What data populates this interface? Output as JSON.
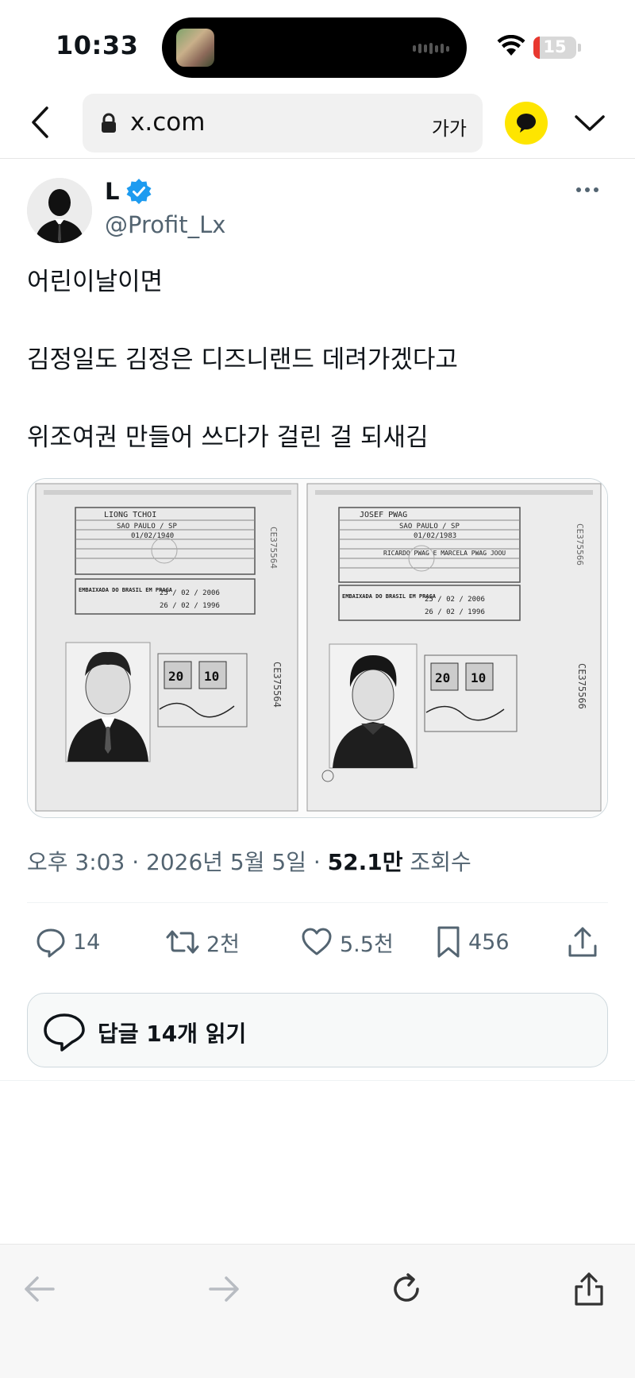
{
  "status_bar": {
    "time": "10:33",
    "battery_level": "15"
  },
  "browser": {
    "url": "x.com",
    "text_size_label": "가가",
    "icons": {
      "back": "chevron-left-icon",
      "lock": "lock-icon",
      "kakao": "speech-bubble-icon",
      "menu": "chevron-down-icon"
    }
  },
  "tweet": {
    "display_name": "L",
    "username": "@Profit_Lx",
    "verified": true,
    "text_lines": [
      "어린이날이면",
      "김정일도 김정은 디즈니랜드 데려가겠다고",
      "위조여권 만들어 쓰다가 걸린 걸 되새김"
    ],
    "timestamp": "오후 3:03 · 2026년 5월 5일 · ",
    "views_count": "52.1만",
    "views_label": " 조회수",
    "actions": {
      "replies": "14",
      "reposts": "2천",
      "likes": "5.5천",
      "bookmarks": "456"
    },
    "read_replies_label": "답글 14개 읽기",
    "media": {
      "left_page": {
        "name": "LIONG TCHOI",
        "header_text": "EMBAIXADA DO BRASIL EM PRAGA",
        "issue_place": "SAO PAULO / SP",
        "dob": "01/02/1940",
        "issued": "25 / 02 / 2006",
        "expires": "26 / 02 / 1996",
        "serial": "CE375564"
      },
      "right_page": {
        "name": "JOSEF PWAG",
        "header_text": "EMBAIXADA DO BRASIL EM PRAGA",
        "issue_place": "SAO PAULO / SP",
        "dob": "01/02/1983",
        "parents": "RICARDO PWAG E MARCELA PWAG JOOU",
        "issued": "25 / 02 / 2006",
        "expires": "26 / 02 / 1996",
        "serial": "CE375566"
      }
    }
  },
  "colors": {
    "accent": "#1d9bf0",
    "secondary_text": "#536471",
    "kakao_yellow": "#fee500",
    "battery_red": "#e8382f"
  }
}
